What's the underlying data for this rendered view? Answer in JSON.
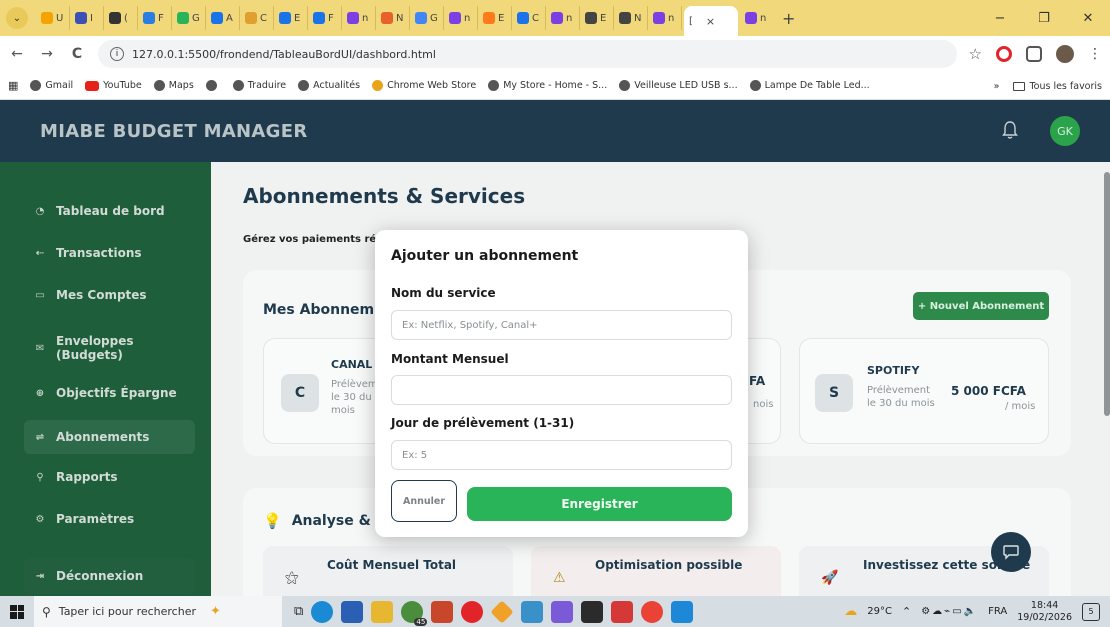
{
  "browser": {
    "url": "127.0.0.1:5500/frondend/TableauBordUI/dashbord.html",
    "tabs": [
      {
        "label": "U",
        "color": "#f4a300"
      },
      {
        "label": "I",
        "color": "#3b4fb5"
      },
      {
        "label": "(",
        "color": "#333333"
      },
      {
        "label": "F",
        "color": "#2a7de1"
      },
      {
        "label": "G",
        "color": "#2ab45a"
      },
      {
        "label": "A",
        "color": "#1a73e8"
      },
      {
        "label": "C",
        "color": "#e0a030"
      },
      {
        "label": "E",
        "color": "#1a73e8"
      },
      {
        "label": "F",
        "color": "#1a73e8"
      },
      {
        "label": "n",
        "color": "#7b3fe4"
      },
      {
        "label": "N",
        "color": "#e8612c"
      },
      {
        "label": "G",
        "color": "#4285f4"
      },
      {
        "label": "n",
        "color": "#7b3fe4"
      },
      {
        "label": "E",
        "color": "#ff7a1a"
      },
      {
        "label": "C",
        "color": "#1a73e8"
      },
      {
        "label": "n",
        "color": "#7b3fe4"
      },
      {
        "label": "E",
        "color": "#444444"
      },
      {
        "label": "N",
        "color": "#444444"
      },
      {
        "label": "n",
        "color": "#7b3fe4"
      }
    ],
    "active_tab": {
      "label": "[",
      "close": "×"
    },
    "last_tab": {
      "label": "n",
      "color": "#7b3fe4"
    },
    "window_controls": {
      "minimize": "−",
      "maximize": "❐",
      "close": "✕"
    },
    "nav": {
      "back": "←",
      "forward": "→",
      "reload": "C"
    },
    "bookmarks": [
      {
        "label": "Gmail",
        "icon": "globe"
      },
      {
        "label": "YouTube",
        "icon": "youtube"
      },
      {
        "label": "Maps",
        "icon": "globe"
      },
      {
        "label": "",
        "icon": "globe"
      },
      {
        "label": "Traduire",
        "icon": "globe"
      },
      {
        "label": "Actualités",
        "icon": "globe"
      },
      {
        "label": "Chrome Web Store",
        "icon": "store"
      },
      {
        "label": "My Store - Home - S...",
        "icon": "globe"
      },
      {
        "label": "Veilleuse LED USB s...",
        "icon": "globe"
      },
      {
        "label": "Lampe De Table Led...",
        "icon": "globe"
      }
    ],
    "bookmarks_more": "»",
    "all_bookmarks": "Tous les favoris"
  },
  "app": {
    "brand": "MIABE BUDGET MANAGER",
    "avatar_initials": "GK",
    "accent": "#2ab45a"
  },
  "sidebar": {
    "items": [
      {
        "label": "Tableau de bord",
        "icon": "◔"
      },
      {
        "label": "Transactions",
        "icon": "⇠"
      },
      {
        "label": "Mes Comptes",
        "icon": "▭"
      },
      {
        "label": "Enveloppes (Budgets)",
        "icon": "✉"
      },
      {
        "label": "Objectifs Épargne",
        "icon": "⊕"
      },
      {
        "label": "Abonnements",
        "icon": "⇌"
      },
      {
        "label": "Rapports",
        "icon": "⚲"
      },
      {
        "label": "Paramètres",
        "icon": "⚙"
      }
    ],
    "logout": {
      "label": "Déconnexion",
      "icon": "⇥"
    }
  },
  "main": {
    "title": "Abonnements & Services",
    "subtitle": "Gérez vos paiements réc",
    "subs_title": "Mes Abonnem",
    "new_button": "+ Nouvel Abonnement",
    "cards": [
      {
        "letter": "C",
        "name": "CANAL",
        "line1": "Prélèvem",
        "line2": "le 30 du",
        "line3": "mois"
      },
      {
        "amount": "FA",
        "small": "nois"
      },
      {
        "letter": "S",
        "name": "SPOTIFY",
        "line1": "Prélèvement",
        "line2": "le 30 du mois",
        "amount": "5 000 FCFA",
        "per": "/ mois"
      }
    ],
    "analysis_title": "Analyse &",
    "analysis_cards": [
      {
        "title": "Coût Mensuel Total",
        "icon": "⚝"
      },
      {
        "title": "Optimisation possible",
        "icon": "⚠"
      },
      {
        "title": "Investissez cette somme",
        "icon": "🚀"
      }
    ]
  },
  "modal": {
    "title": "Ajouter un abonnement",
    "service_label": "Nom du service",
    "service_placeholder": "Ex: Netflix, Spotify, Canal+",
    "amount_label": "Montant Mensuel",
    "amount_value": "",
    "day_label": "Jour de prélèvement (1-31)",
    "day_placeholder": "Ex: 5",
    "cancel": "Annuler",
    "save": "Enregistrer"
  },
  "taskbar": {
    "search_placeholder": "Taper ici pour rechercher",
    "badge": "45",
    "weather": "29°C",
    "lang": "FRA",
    "time": "18:44",
    "date": "19/02/2026",
    "notifications": "5"
  }
}
